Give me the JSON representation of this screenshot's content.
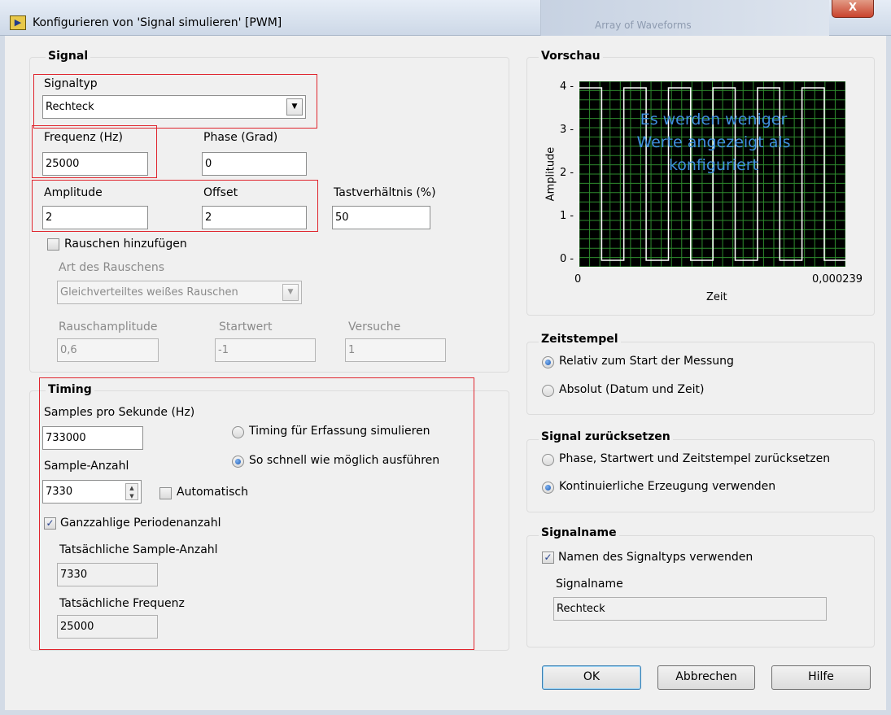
{
  "window": {
    "title": "Konfigurieren von 'Signal simulieren' [PWM]",
    "background_window_text": "Array of Waveforms",
    "close_label": "X"
  },
  "signal": {
    "group_title": "Signal",
    "signaltyp_label": "Signaltyp",
    "signaltyp_value": "Rechteck",
    "frequenz_label": "Frequenz (Hz)",
    "frequenz_value": "25000",
    "phase_label": "Phase (Grad)",
    "phase_value": "0",
    "amplitude_label": "Amplitude",
    "amplitude_value": "2",
    "offset_label": "Offset",
    "offset_value": "2",
    "tastverhaeltnis_label": "Tastverhältnis (%)",
    "tastverhaeltnis_value": "50",
    "rauschen_label": "Rauschen hinzufügen",
    "rauschen_checked": false,
    "art_label": "Art des Rauschens",
    "art_value": "Gleichverteiltes weißes Rauschen",
    "rauschamplitude_label": "Rauschamplitude",
    "rauschamplitude_value": "0,6",
    "startwert_label": "Startwert",
    "startwert_value": "-1",
    "versuche_label": "Versuche",
    "versuche_value": "1"
  },
  "timing": {
    "group_title": "Timing",
    "samples_label": "Samples pro Sekunde (Hz)",
    "samples_value": "733000",
    "radio_simulate_label": "Timing für Erfassung simulieren",
    "radio_fast_label": "So schnell wie möglich ausführen",
    "selected_radio": "fast",
    "anzahl_label": "Sample-Anzahl",
    "anzahl_value": "7330",
    "automatisch_label": "Automatisch",
    "automatisch_checked": false,
    "ganzzahlig_label": "Ganzzahlige Periodenanzahl",
    "ganzzahlig_checked": true,
    "tats_anzahl_label": "Tatsächliche Sample-Anzahl",
    "tats_anzahl_value": "7330",
    "tats_freq_label": "Tatsächliche Frequenz",
    "tats_freq_value": "25000"
  },
  "preview": {
    "group_title": "Vorschau",
    "overlay_text": "Es werden weniger Werte angezeigt als konfiguriert"
  },
  "chart_data": {
    "type": "line",
    "xlabel": "Zeit",
    "ylabel": "Amplitude",
    "xlim": [
      0,
      0.000239
    ],
    "ylim": [
      0,
      4
    ],
    "x_tick_labels": [
      "0",
      "0,000239"
    ],
    "y_tick_labels": [
      "0",
      "1",
      "2",
      "3",
      "4"
    ],
    "series": [
      {
        "frequency_hz": 25000,
        "amplitude": 2,
        "offset": 2,
        "duty_percent": 50,
        "low": 0,
        "high": 4
      }
    ],
    "grid": true,
    "colors": {
      "background": "#000000",
      "grid": "#2e8b2e",
      "trace": "#ffffff",
      "overlay_text": "#3f8fde"
    }
  },
  "zeitstempel": {
    "group_title": "Zeitstempel",
    "relativ_label": "Relativ zum Start der Messung",
    "absolut_label": "Absolut (Datum und Zeit)",
    "selected": "relativ"
  },
  "reset": {
    "group_title": "Signal zurücksetzen",
    "phase_reset_label": "Phase, Startwert und Zeitstempel zurücksetzen",
    "kontinuierlich_label": "Kontinuierliche Erzeugung verwenden",
    "selected": "kontinuierlich"
  },
  "signalname": {
    "group_title": "Signalname",
    "use_type_label": "Namen des Signaltyps verwenden",
    "use_type_checked": true,
    "name_label": "Signalname",
    "name_value": "Rechteck"
  },
  "buttons": {
    "ok": "OK",
    "abbrechen": "Abbrechen",
    "hilfe": "Hilfe"
  },
  "colors": {
    "highlight_box": "#e0252e",
    "default_button_border": "#3c7fb1"
  }
}
